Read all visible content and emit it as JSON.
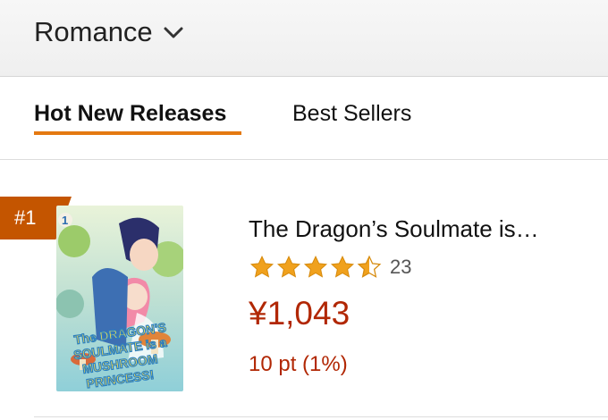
{
  "category": {
    "label": "Romance",
    "icon": "chevron-down-icon"
  },
  "tabs": [
    {
      "label": "Hot New Releases",
      "active": true
    },
    {
      "label": "Best Sellers",
      "active": false
    }
  ],
  "item": {
    "rank": "#1",
    "title": "The Dragon’s Soulmate is…",
    "rating": 4.5,
    "review_count": "23",
    "price": "¥1,043",
    "points": "10 pt (1%)",
    "cover": {
      "title_lines": [
        "The DRAGON'S",
        "SOULMATE is a",
        "MUSHROOM",
        "PRINCESS!"
      ],
      "volume": "1"
    }
  },
  "colors": {
    "accent": "#e47911",
    "badge": "#c45500",
    "price": "#b12704",
    "star": "#f0a11d"
  }
}
